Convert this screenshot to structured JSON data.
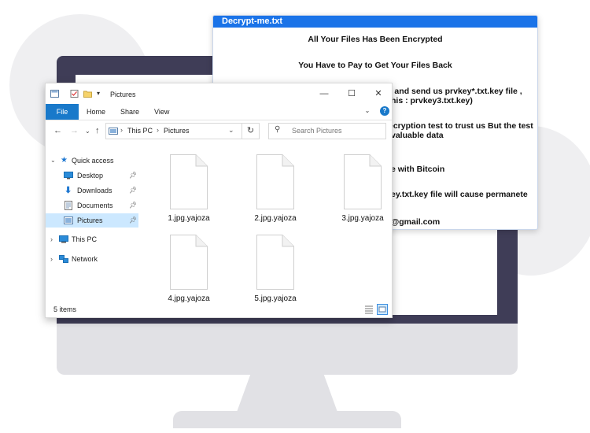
{
  "notepad": {
    "title": "Decrypt-me.txt",
    "lines": [
      "All Your Files Has Been Encrypted",
      "You Have to Pay to Get Your Files Back",
      "yes   and send us prvkey*.txt.key  file ,",
      "his : prvkey3.txt.key)",
      "ecryption test to trust us But the test",
      "valuable data",
      "e with Bitcoin",
      "ey.txt.key file will cause permanete",
      "@gmail.com"
    ]
  },
  "explorer": {
    "title": "Pictures",
    "ribbon_tabs": [
      "File",
      "Home",
      "Share",
      "View"
    ],
    "help_label": "?",
    "breadcrumb": [
      "This PC",
      "Pictures"
    ],
    "search_placeholder": "Search Pictures",
    "nav_items": [
      {
        "label": "Quick access",
        "icon": "star-icon"
      },
      {
        "label": "Desktop",
        "icon": "desktop-icon"
      },
      {
        "label": "Downloads",
        "icon": "download-icon"
      },
      {
        "label": "Documents",
        "icon": "documents-icon"
      },
      {
        "label": "Pictures",
        "icon": "pictures-icon"
      },
      {
        "label": "This PC",
        "icon": "computer-icon"
      },
      {
        "label": "Network",
        "icon": "network-icon"
      }
    ],
    "files": [
      "1.jpg.yajoza",
      "2.jpg.yajoza",
      "3.jpg.yajoza",
      "4.jpg.yajoza",
      "5.jpg.yajoza"
    ],
    "status": "5 items"
  },
  "colors": {
    "accent": "#1a73e8",
    "file_tab": "#1979ca",
    "monitor_frame": "#3f3d57",
    "monitor_stand": "#e1e1e5",
    "selected_nav": "#cce8ff"
  }
}
